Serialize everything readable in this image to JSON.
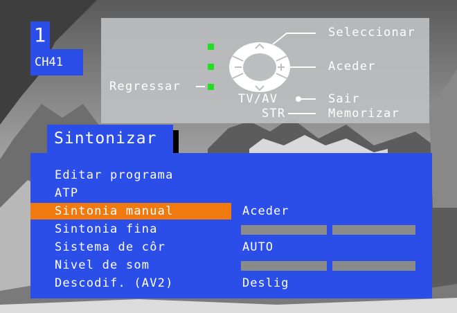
{
  "channel": {
    "number": "1",
    "name": "CH41"
  },
  "help": {
    "select_label": "Seleccionar",
    "enter_label": "Aceder",
    "back_label": "Regressar",
    "tvav_label": "TV/AV",
    "exit_label": "Sair",
    "str_label": "STR",
    "store_label": "Memorizar"
  },
  "menu": {
    "title": "Sintonizar",
    "items": [
      {
        "label": "Editar programa",
        "value": ""
      },
      {
        "label": "ATP",
        "value": ""
      },
      {
        "label": "Sintonia manual",
        "value": "Aceder",
        "selected": true
      },
      {
        "label": "Sintonia fina",
        "value": ""
      },
      {
        "label": "Sistema de côr",
        "value": "AUTO"
      },
      {
        "label": "Nivel de som",
        "value": ""
      },
      {
        "label": "Descodif. (AV2)",
        "value": "Deslig"
      }
    ]
  },
  "colors": {
    "panel": "#2b4de8",
    "highlight": "#f07a10",
    "indicator": "#22dd22",
    "help_box": "#bcbec0"
  }
}
